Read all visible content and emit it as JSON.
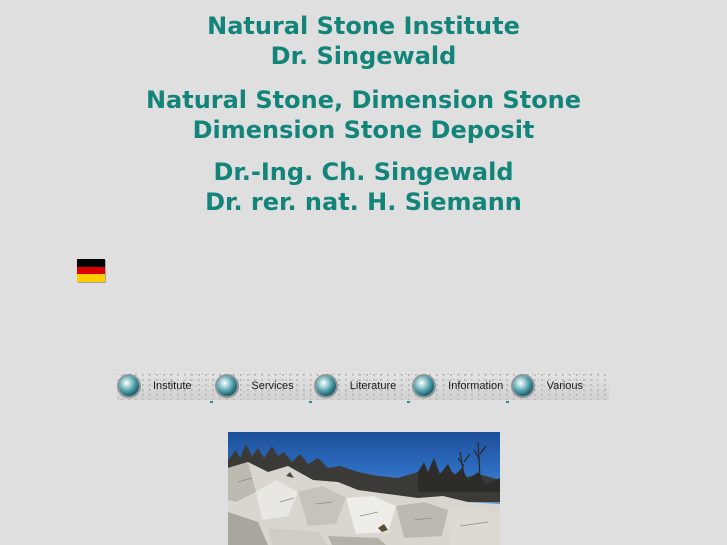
{
  "header": {
    "line1": "Natural Stone Institute",
    "line2": "Dr. Singewald",
    "line3": "Natural Stone, Dimension Stone",
    "line4": "Dimension Stone Deposit",
    "line5": "Dr.-Ing. Ch. Singewald",
    "line6": "Dr. rer. nat. H. Siemann"
  },
  "language_flag": {
    "icon": "german-flag-icon",
    "colors": [
      "#000000",
      "#dd0000",
      "#ffce00"
    ]
  },
  "nav": {
    "items": [
      {
        "label": "Institute",
        "icon": "orb-bullet-icon"
      },
      {
        "label": "Services",
        "icon": "orb-bullet-icon"
      },
      {
        "label": "Literature",
        "icon": "orb-bullet-icon"
      },
      {
        "label": "Information",
        "icon": "orb-bullet-icon"
      },
      {
        "label": "Various",
        "icon": "orb-bullet-icon"
      }
    ]
  },
  "theme": {
    "background": "#dfdfdf",
    "heading_color": "#138479"
  },
  "hero_image": {
    "subject": "marble-quarry-photo"
  }
}
